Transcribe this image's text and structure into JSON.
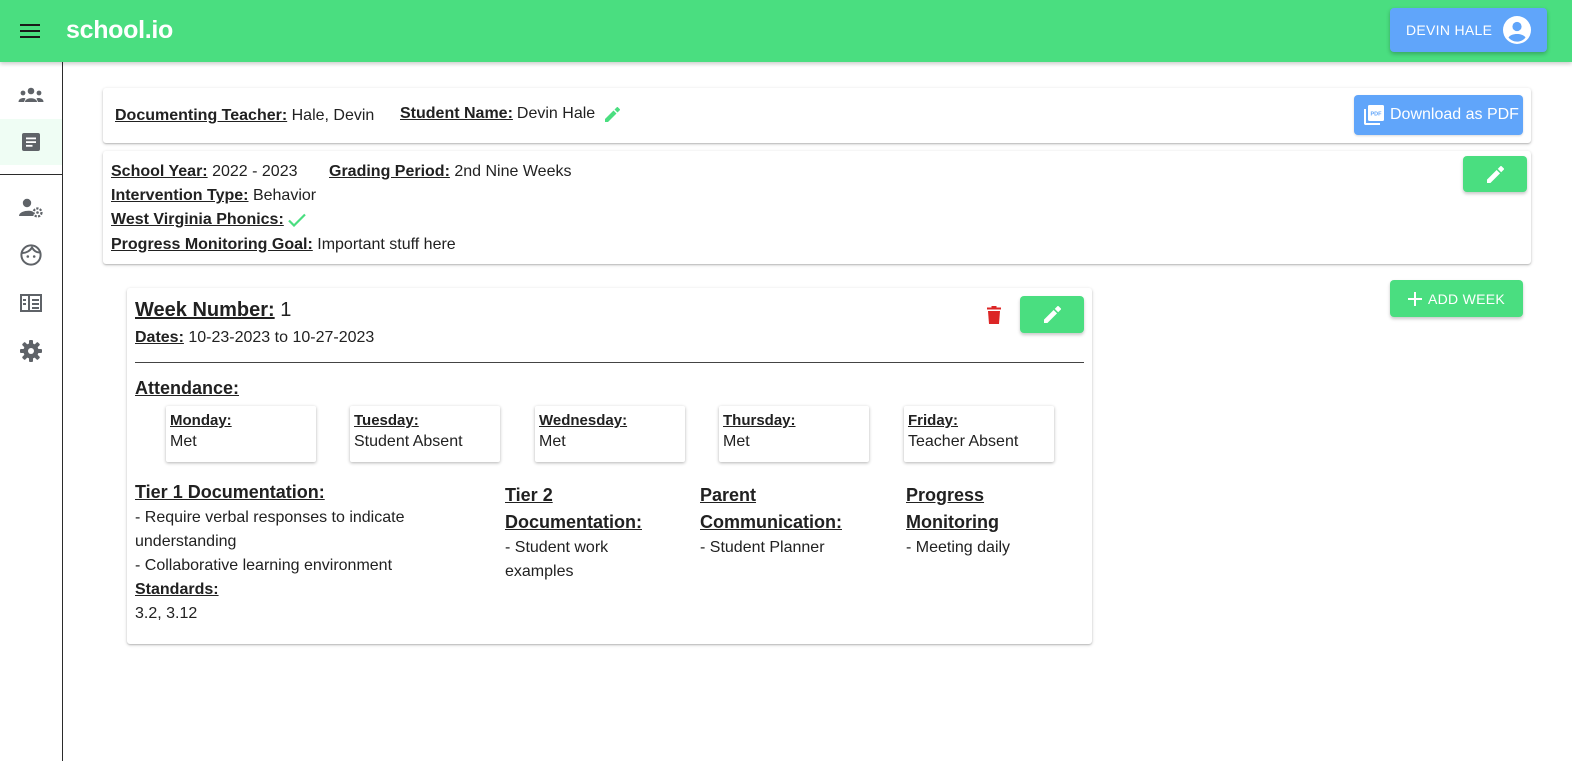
{
  "app": {
    "brand": "school.io",
    "user_name": "DEVIN HALE",
    "colors": {
      "primary_green": "#4ade80",
      "accent_blue": "#60a5fa",
      "danger_red": "#dc2626"
    }
  },
  "sidebar": {
    "items": [
      {
        "icon": "groups-icon"
      },
      {
        "icon": "document-icon",
        "active": true
      },
      {
        "icon": "user-settings-icon"
      },
      {
        "icon": "student-face-icon"
      },
      {
        "icon": "records-icon"
      },
      {
        "icon": "gear-icon"
      }
    ]
  },
  "header_card": {
    "teacher_label": "Documenting Teacher:",
    "teacher_value": "Hale, Devin",
    "student_label": "Student Name:",
    "student_value": "Devin Hale",
    "pdf_label": "Download as PDF"
  },
  "plan_card": {
    "school_year_label": "School Year:",
    "school_year_value": "2022 - 2023",
    "grading_period_label": "Grading Period:",
    "grading_period_value": "2nd Nine Weeks",
    "intervention_label": "Intervention Type:",
    "intervention_value": "Behavior",
    "phonics_label": "West Virginia Phonics:",
    "goal_label": "Progress Monitoring Goal:",
    "goal_value": "Important stuff here"
  },
  "add_week_label": "ADD WEEK",
  "week": {
    "number_label": "Week Number:",
    "number_value": "1",
    "dates_label": "Dates:",
    "dates_value": "10-23-2023 to 10-27-2023",
    "attendance_label": "Attendance:",
    "days": [
      {
        "label": "Monday:",
        "value": "Met"
      },
      {
        "label": "Tuesday:",
        "value": "Student Absent"
      },
      {
        "label": "Wednesday:",
        "value": "Met"
      },
      {
        "label": "Thursday:",
        "value": "Met"
      },
      {
        "label": "Friday:",
        "value": "Teacher Absent"
      }
    ],
    "tier1": {
      "title": "Tier 1 Documentation:",
      "items": [
        "- Require verbal responses to indicate understanding",
        "- Collaborative learning environment"
      ],
      "standards_label": "Standards:",
      "standards_value": "3.2, 3.12"
    },
    "tier2": {
      "title": "Tier 2 Documentation:",
      "items": [
        "- Student work examples"
      ]
    },
    "parent": {
      "title": "Parent Communication:",
      "items": [
        "- Student Planner"
      ]
    },
    "progress": {
      "title": "Progress Monitoring",
      "items": [
        "- Meeting daily"
      ]
    }
  }
}
